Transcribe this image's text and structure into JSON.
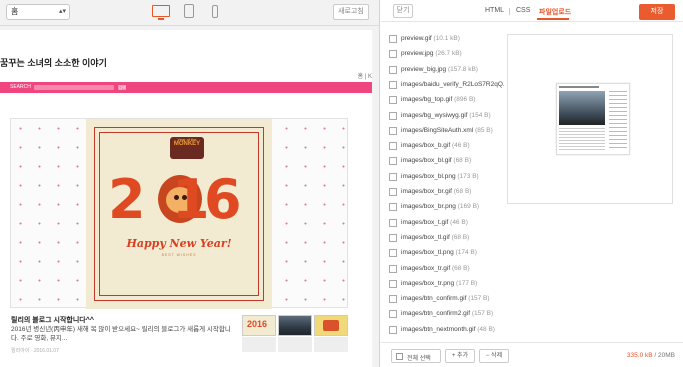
{
  "left_toolbar": {
    "select_value": "홈",
    "refresh_label": "새로고침"
  },
  "preview": {
    "blog_title": "꿈꾸는 소녀의 소소한 이야기",
    "breadcrumb": "홈 | K",
    "search_label": "SEARCH",
    "search_button": "검색",
    "post": {
      "title": "릴리의 블로그 시작합니다^^",
      "body": "2016년 병신년(丙申年) 새해 복 많이 받으세요~ 릴리의 블로그가 새롭게 시작합니다. 주로 영화, 뮤지...",
      "meta": "릴리아이 · 2016.01.07"
    },
    "poster": {
      "badge_line1": "Year of the",
      "badge_line2": "MONKEY",
      "digits": [
        "2",
        "0",
        "1",
        "6"
      ],
      "greeting": "Happy New Year!",
      "subtext": "BEST WISHES"
    }
  },
  "right_panel": {
    "close_label": "닫기",
    "tabs": [
      "HTML",
      "CSS",
      "파일업로드"
    ],
    "active_tab": "파일업로드",
    "save_label": "저장",
    "files": [
      {
        "name": "preview.gif",
        "size": "(10.1 kB)"
      },
      {
        "name": "preview.jpg",
        "size": "(26.7 kB)"
      },
      {
        "name": "preview_big.jpg",
        "size": "(157.8 kB)"
      },
      {
        "name": "images/baidu_verify_R2LoS7R2qQ.html",
        "size": ""
      },
      {
        "name": "images/bg_top.gif",
        "size": "(896 B)"
      },
      {
        "name": "images/bg_wysiwyg.gif",
        "size": "(154 B)"
      },
      {
        "name": "images/BingSiteAuth.xml",
        "size": "(85 B)"
      },
      {
        "name": "images/box_b.gif",
        "size": "(46 B)"
      },
      {
        "name": "images/box_bl.gif",
        "size": "(68 B)"
      },
      {
        "name": "images/box_bl.png",
        "size": "(173 B)"
      },
      {
        "name": "images/box_br.gif",
        "size": "(68 B)"
      },
      {
        "name": "images/box_br.png",
        "size": "(169 B)"
      },
      {
        "name": "images/box_t.gif",
        "size": "(46 B)"
      },
      {
        "name": "images/box_tl.gif",
        "size": "(68 B)"
      },
      {
        "name": "images/box_tl.png",
        "size": "(174 B)"
      },
      {
        "name": "images/box_tr.gif",
        "size": "(68 B)"
      },
      {
        "name": "images/box_tr.png",
        "size": "(177 B)"
      },
      {
        "name": "images/btn_confirm.gif",
        "size": "(157 B)"
      },
      {
        "name": "images/btn_confirm2.gif",
        "size": "(157 B)"
      },
      {
        "name": "images/btn_nextmonth.gif",
        "size": "(48 B)"
      }
    ],
    "footer": {
      "select_all": "전체 선택",
      "add": "+ 추가",
      "delete": "− 삭제",
      "usage_used": "335.0 kB",
      "usage_total": " / 20MB"
    },
    "accent_color": "#e8562a"
  }
}
